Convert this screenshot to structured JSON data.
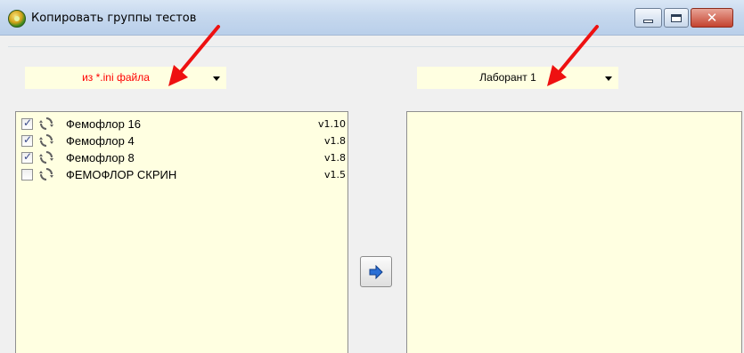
{
  "window": {
    "title": "Копировать группы тестов",
    "title_icon": "app-flower-icon"
  },
  "source_combo": {
    "value": "из *.ini файла",
    "text_color": "#ff0000"
  },
  "target_combo": {
    "value": "Лаборант 1",
    "text_color": "#000000"
  },
  "source_list": {
    "items": [
      {
        "name": "Фемофлор 16",
        "version": "v1.10",
        "checked": true
      },
      {
        "name": "Фемофлор 4",
        "version": "v1.8",
        "checked": true
      },
      {
        "name": "Фемофлор 8",
        "version": "v1.8",
        "checked": true
      },
      {
        "name": "ФЕМОФЛОР СКРИН",
        "version": "v1.5",
        "checked": false
      }
    ]
  },
  "target_list": {
    "items": []
  },
  "copy_button": {
    "icon": "arrow-right-icon"
  },
  "colors": {
    "list_background": "#ffffe1",
    "annotation_arrow": "#ee1111"
  }
}
